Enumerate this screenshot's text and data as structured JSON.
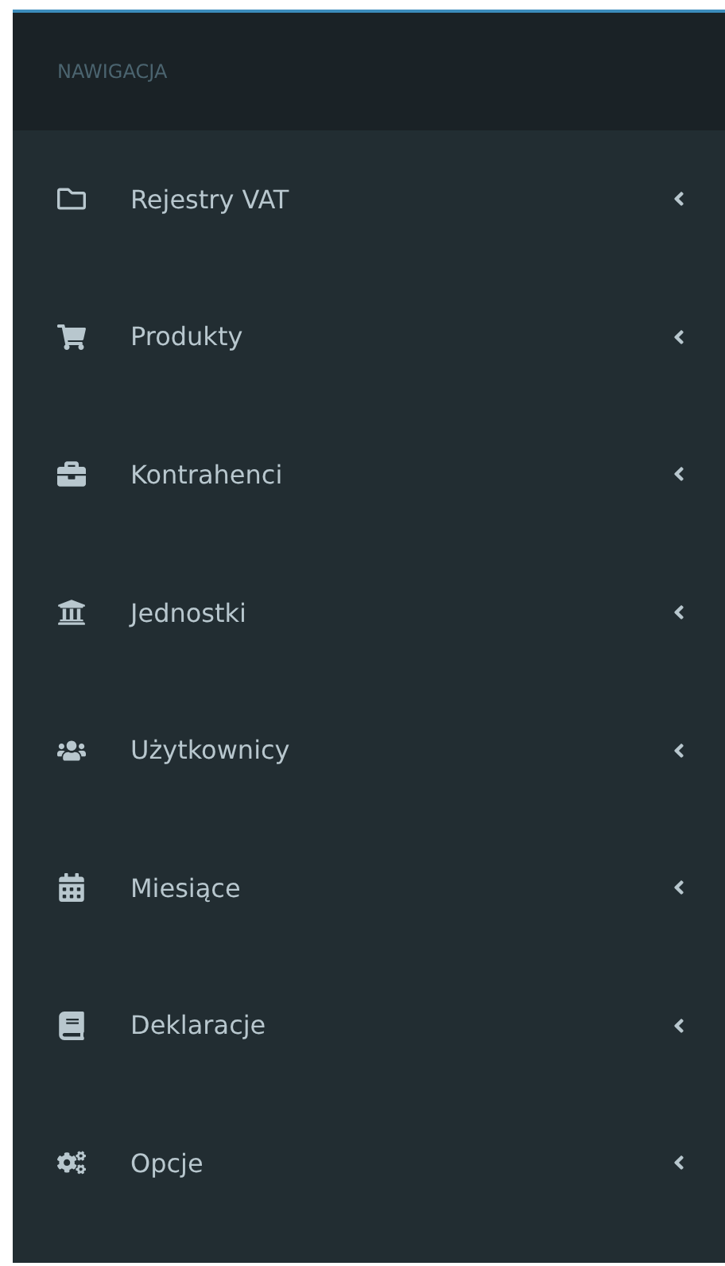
{
  "sidebar": {
    "header": "NAWIGACJA",
    "items": [
      {
        "label": "Rejestry VAT",
        "expanded": false
      },
      {
        "label": "Produkty",
        "expanded": false
      },
      {
        "label": "Kontrahenci",
        "expanded": false
      },
      {
        "label": "Jednostki",
        "expanded": false
      },
      {
        "label": "Użytkownicy",
        "expanded": false
      },
      {
        "label": "Miesiące",
        "expanded": false
      },
      {
        "label": "Deklaracje",
        "expanded": false
      },
      {
        "label": "Opcje",
        "expanded": false
      }
    ]
  }
}
